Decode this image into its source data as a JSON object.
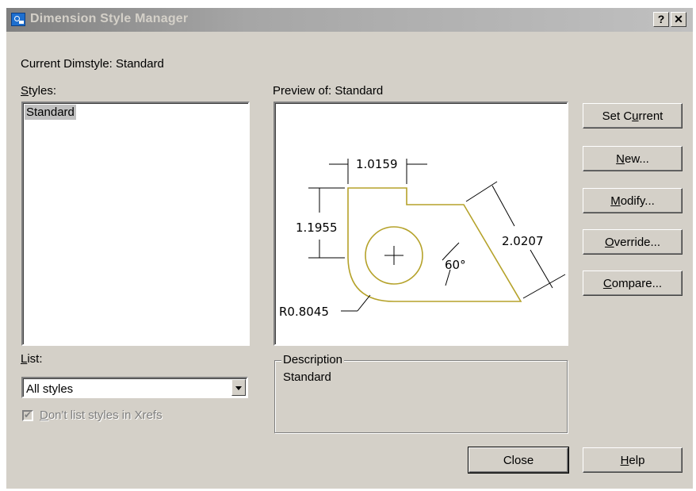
{
  "window": {
    "title": "Dimension Style Manager",
    "help_glyph": "?",
    "close_glyph": "✕"
  },
  "current_dimstyle": "Current Dimstyle: Standard",
  "styles": {
    "label_pre": "",
    "label_key": "S",
    "label_post": "tyles:",
    "items": [
      "Standard"
    ]
  },
  "list": {
    "label_key": "L",
    "label_post": "ist:",
    "selected": "All styles"
  },
  "xrefs_checkbox": {
    "key": "D",
    "label_post": "on't list styles in Xrefs",
    "checked": true,
    "enabled": false
  },
  "preview": {
    "label": "Preview of: Standard",
    "dims": {
      "width": "1.0159",
      "height": "1.1955",
      "diagonal": "2.0207",
      "angle": "60°",
      "radius": "R0.8045"
    },
    "colors": {
      "outline": "#b5a22a",
      "dim": "#000000"
    }
  },
  "description": {
    "legend": "Description",
    "text": "Standard"
  },
  "buttons": {
    "set_current": {
      "pre": "Set C",
      "key": "u",
      "post": "rrent"
    },
    "new": {
      "pre": "",
      "key": "N",
      "post": "ew..."
    },
    "modify": {
      "pre": "",
      "key": "M",
      "post": "odify..."
    },
    "override": {
      "pre": "",
      "key": "O",
      "post": "verride..."
    },
    "compare": {
      "pre": "",
      "key": "C",
      "post": "ompare..."
    },
    "close": {
      "label": "Close"
    },
    "help": {
      "pre": "",
      "key": "H",
      "post": "elp"
    }
  }
}
